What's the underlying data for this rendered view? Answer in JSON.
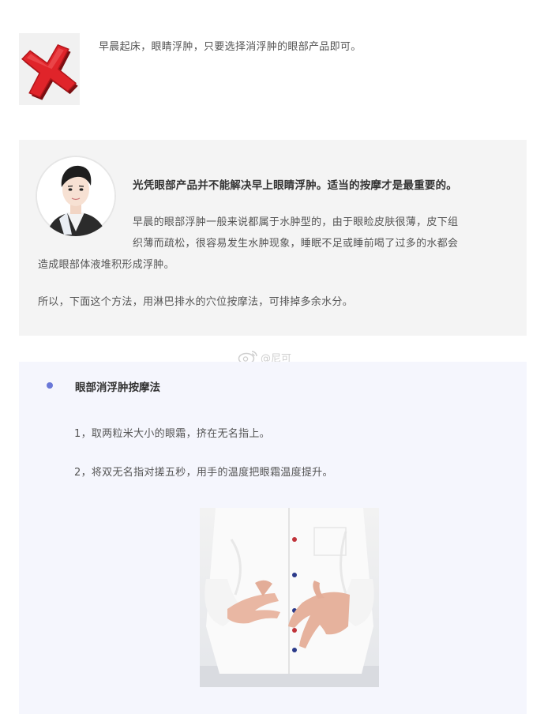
{
  "wrong_tip": {
    "icon": "red-x-icon",
    "text": "早晨起床，眼睛浮肿，只要选择消浮肿的眼部产品即可。"
  },
  "expert_card": {
    "avatar_icon": "expert-avatar-icon",
    "headline": "光凭眼部产品并不能解决早上眼睛浮肿。适当的按摩才是最重要的。",
    "paragraph_lines": [
      "早晨的眼部浮肿一般来说都属于水肿型的，由于眼睑皮肤很薄，皮下组",
      "织薄而疏松，很容易发生水肿现象，睡眠不足或睡前喝了过多的水都会",
      "造成眼部体液堆积形成浮肿。"
    ],
    "conclusion": "所以，下面这个方法，用淋巴排水的穴位按摩法，可排掉多余水分。"
  },
  "watermark": {
    "icon": "weibo-icon",
    "text": "@尼可"
  },
  "method": {
    "title": "眼部消浮肿按摩法",
    "steps": [
      "1，取两粒米大小的眼霜，挤在无名指上。",
      "2，将双无名指对搓五秒，用手的温度把眼霜温度提升。"
    ],
    "photo": "hands-rubbing-ring-fingers-photo"
  },
  "colors": {
    "accent_bullet": "#6a78d8",
    "gray_card": "#f4f4f4",
    "lavender_card": "#f5f6fd",
    "x_red": "#e0242a"
  }
}
